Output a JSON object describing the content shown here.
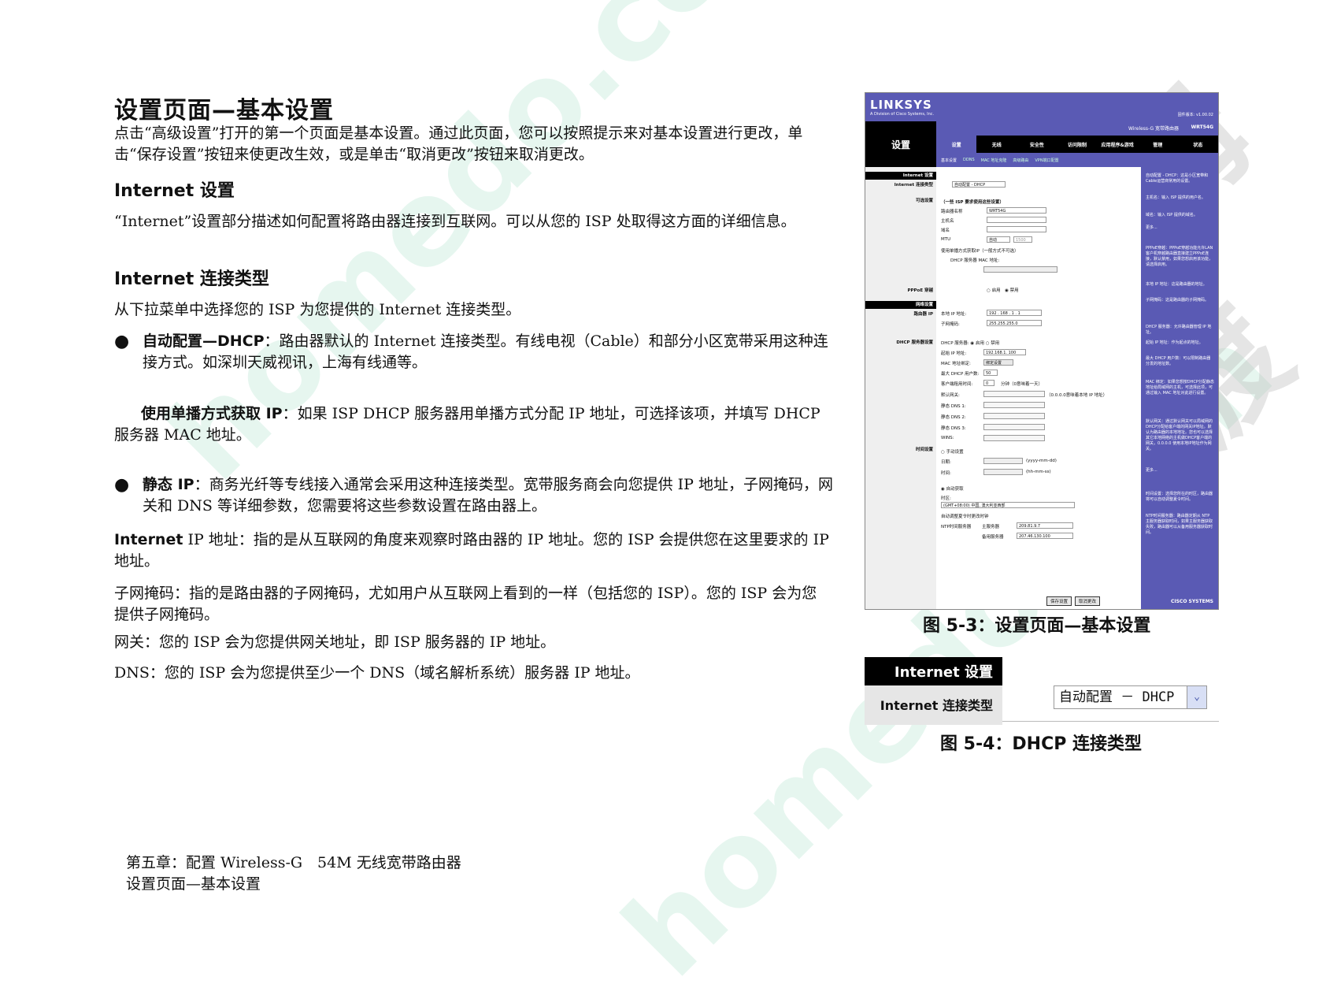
{
  "page": {
    "title": "设置页面—基本设置",
    "intro": "点击“高级设置”打开的第一个页面是基本设置。通过此页面，您可以按照提示来对基本设置进行更改，单击“保存设置”按钮来使更改生效，或是单击“取消更改”按钮来取消更改。",
    "section_internet": "Internet 设置",
    "internet_desc": "“Internet”设置部分描述如何配置将路由器连接到互联网。可以从您的 ISP 处取得这方面的详细信息。",
    "section_conn_type": "Internet 连接类型",
    "conn_type_desc": "从下拉菜单中选择您的 ISP 为您提供的 Internet 连接类型。",
    "bullet_dhcp_bold": "自动配置—DHCP",
    "bullet_dhcp_text": "：路由器默认的 Internet 连接类型。有线电视（Cable）和部分小区宽带采用这种连接方式。如深圳天威视讯，上海有线通等。",
    "unicast_bold": "使用单播方式获取 IP",
    "unicast_text": "：如果 ISP DHCP 服务器用单播方式分配 IP 地址，可选择该项，并填写 DHCP 服务器 MAC 地址。",
    "bullet_static_bold": "静态 IP",
    "bullet_static_text": "：商务光纤等专线接入通常会采用这种连接类型。宽带服务商会向您提供 IP 地址，子网掩码，网关和 DNS 等详细参数，您需要将这些参数设置在路由器上。",
    "ip_addr_bold": "Internet",
    "ip_addr_text": " IP 地址：指的是从互联网的角度来观察时路由器的 IP 地址。您的 ISP 会提供您在这里要求的 IP 地址。",
    "subnet_text": "子网掩码：指的是路由器的子网掩码，尤如用户从互联网上看到的一样（包括您的 ISP）。您的 ISP 会为您提供子网掩码。",
    "gateway_text": "网关：您的 ISP 会为您提供网关地址，即 ISP 服务器的 IP 地址。",
    "dns_text": "DNS：您的 ISP 会为您提供至少一个 DNS（域名解析系统）服务器 IP 地址。",
    "footer_line1": "第五章：配置 Wireless-G　54M 无线宽带路由器",
    "footer_line2": "设置页面—基本设置",
    "bullet_glyph": "●"
  },
  "figure1": {
    "caption": "图 5-3：设置页面—基本设置",
    "logo": "LINKSYS",
    "logo_sub": "A Division of Cisco Systems, Inc.",
    "firmware": "固件版本: v1.00.02",
    "section": "设置",
    "product": "Wireless-G 宽带路由器",
    "model": "WRT54G",
    "tabs": [
      "设置",
      "无线",
      "安全性",
      "访问限制",
      "应用程序&游戏",
      "管理",
      "状态"
    ],
    "subtabs": [
      "基本设置",
      "DDNS",
      "MAC 地址克隆",
      "高级路由",
      "VPN端口配置"
    ],
    "left_labels": {
      "internet_setup": "Internet 设置",
      "conn_type": "Internet 连接类型",
      "optional": "可选设置",
      "pppoe": "PPPoE 穿越",
      "network": "网络设置",
      "router_ip": "路由器 IP",
      "dhcp": "DHCP 服务器设置",
      "time": "时间设置"
    },
    "fields": {
      "conn_select": "自动配置 - DHCP",
      "isp_note": "（一些 ISP 要求使用这些设置）",
      "router_name_label": "路由器名称",
      "router_name": "WRT54G",
      "host_label": "主机名",
      "domain_label": "域名",
      "mtu_label": "MTU",
      "mtu_val": "自动",
      "mtu_size": "1500",
      "unicast_chk": "使用单播方式获取IP（一般方式不可选）",
      "dhcp_mac_label": "DHCP 服务器 MAC 地址:",
      "pppoe_enable": "启用",
      "pppoe_disable": "禁用",
      "local_ip_label": "本地 IP 地址:",
      "local_ip": "192 . 168 . 1 . 1",
      "subnet_label": "子网掩码:",
      "subnet": "255.255.255.0",
      "dhcp_server_label": "DHCP 服务器:",
      "dhcp_enable": "启用",
      "dhcp_disable": "禁用",
      "start_ip_label": "起始 IP 地址:",
      "start_ip": "192.168.1. 100",
      "mac_bind_label": "MAC 地址绑定:",
      "mac_bind_btn": "绑定设置",
      "max_users_label": "最大 DHCP 用户数:",
      "max_users": "50",
      "lease_label": "客户端租用时间:",
      "lease": "0",
      "lease_unit": "分钟（0意味着一天）",
      "gw_label": "默认网关:",
      "gw_note": "（0.0.0.0意味着本地 IP 地址）",
      "dns1_label": "静态 DNS 1:",
      "dns2_label": "静态 DNS 2:",
      "dns3_label": "静态 DNS 3:",
      "wins_label": "WINS:",
      "manual_label": "手动设置",
      "date_label": "日期:",
      "date_fmt": "(yyyy-mm-dd)",
      "time_label": "时间:",
      "time_fmt": "(hh-mm-ss)",
      "auto_label": "自动获取",
      "tz_label": "时区:",
      "tz": "(GMT+08:00) 中国, 澳大利亚西部",
      "dst_chk": "自动调整夏令时更改时钟",
      "ntp_label": "NTP时间服务器",
      "ntp_primary_label": "主服务器",
      "ntp_primary": "209.81.9.7",
      "ntp_backup_label": "备用服务器",
      "ntp_backup": "207.46.130.100"
    },
    "help": [
      "自动配置 - DHCP：这是小区宽带和Cable运营商常用的设置。",
      "主机名：输入 ISP 提供的用户名。",
      "域名：输入 ISP 提供的域名。",
      "更多...",
      "PPPoE穿越：PPPoE穿越功能允许LAN客户机穿越路由器直接建立PPPoE连接，默认禁用，如果您想启用该功能，请选择启用。",
      "本地 IP 地址：这是路由器的地址。",
      "子网掩码：这是路由器的子网掩码。",
      "DHCP 服务器：允许路由器管理 IP 地址。",
      "起始 IP 地址：作为起点的地址。",
      "最大 DHCP 用户数：可以限制路由器分发的地址数。",
      "MAC 绑定：如果您想按DHCP分配静态地址给局域网的主机，可选择此项，可通过输入 MAC 地址对此进行设置。",
      "默认网关：通过默认网关可以局域网的DHCP分配给客户端的网关IP地址。默认为路由器的本地地址。您也可以选择其它本地网络的主机做DHCP客户端的网关，0.0.0.0 使用本地IP地址作为网关。",
      "更多...",
      "时间设置：选择您所在的时区，路由器将可以自动调整夏令时间。",
      "NTP时间服务器：路由器定期从 NTP 主服务器获取时间，如果主服务器获取失败，路由器可以从备用服务器获取时间。"
    ],
    "save_btn": "保存设置",
    "cancel_btn": "取消更改",
    "cisco": "CISCO SYSTEMS"
  },
  "figure2": {
    "caption": "图 5-4：DHCP 连接类型",
    "header": "Internet 设置",
    "label": "Internet 连接类型",
    "select_value": "自动配置 － DHCP",
    "arrow_glyph": "⌄"
  },
  "watermark": {
    "text1": "homedo.com",
    "text2": "河姆渡",
    "color": "#cfeaf0"
  }
}
